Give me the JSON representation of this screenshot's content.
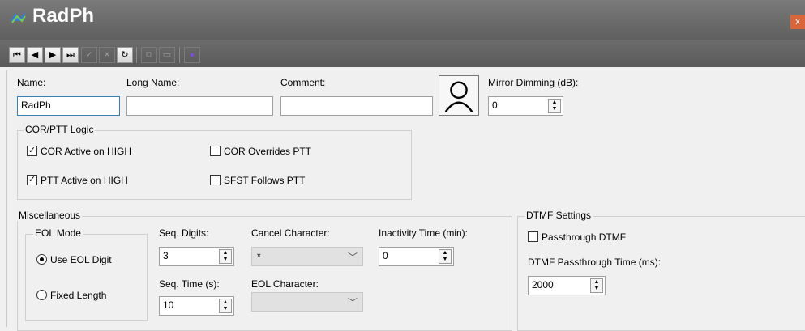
{
  "window": {
    "title": "RadPh",
    "close_label": "x"
  },
  "toolbar": {
    "buttons": [
      {
        "icon": "first-record-icon",
        "glyph": "⏮"
      },
      {
        "icon": "prev-record-icon",
        "glyph": "◀"
      },
      {
        "icon": "next-record-icon",
        "glyph": "▶"
      },
      {
        "icon": "last-record-icon",
        "glyph": "⏭"
      },
      {
        "icon": "check-icon",
        "glyph": "✓"
      },
      {
        "icon": "cancel-icon",
        "glyph": "✕"
      },
      {
        "icon": "refresh-icon",
        "glyph": "↻"
      },
      {
        "icon": "copy-icon",
        "glyph": "⧉"
      },
      {
        "icon": "paste-icon",
        "glyph": "▭"
      },
      {
        "icon": "globe-icon",
        "glyph": "●"
      }
    ]
  },
  "fields": {
    "name_label": "Name:",
    "name_value": "RadPh",
    "long_name_label": "Long Name:",
    "long_name_value": "",
    "comment_label": "Comment:",
    "comment_value": "",
    "mirror_dimming_label": "Mirror Dimming (dB):",
    "mirror_dimming_value": "0"
  },
  "cor_ptt": {
    "title": "COR/PTT Logic",
    "cor_active_high": {
      "label": "COR Active on HIGH",
      "checked": true
    },
    "ptt_active_high": {
      "label": "PTT Active on HIGH",
      "checked": true
    },
    "cor_overrides_ptt": {
      "label": "COR Overrides PTT",
      "checked": false
    },
    "sfst_follows_ptt": {
      "label": "SFST Follows PTT",
      "checked": false
    }
  },
  "misc": {
    "title": "Miscellaneous",
    "eol_mode": {
      "title": "EOL Mode",
      "use_eol_digit": {
        "label": "Use EOL Digit",
        "selected": true
      },
      "fixed_length": {
        "label": "Fixed Length",
        "selected": false
      }
    },
    "seq_digits_label": "Seq. Digits:",
    "seq_digits_value": "3",
    "seq_time_label": "Seq. Time (s):",
    "seq_time_value": "10",
    "cancel_char_label": "Cancel Character:",
    "cancel_char_value": "*",
    "eol_char_label": "EOL Character:",
    "eol_char_value": "",
    "inactivity_label": "Inactivity Time (min):",
    "inactivity_value": "0"
  },
  "dtmf": {
    "title": "DTMF Settings",
    "passthrough": {
      "label": "Passthrough DTMF",
      "checked": false
    },
    "passthrough_time_label": "DTMF Passthrough Time (ms):",
    "passthrough_time_value": "2000"
  },
  "colors": {
    "titlebar": "#6b6b6b",
    "focus_border": "#3c7fb1",
    "close": "#d9653b"
  }
}
